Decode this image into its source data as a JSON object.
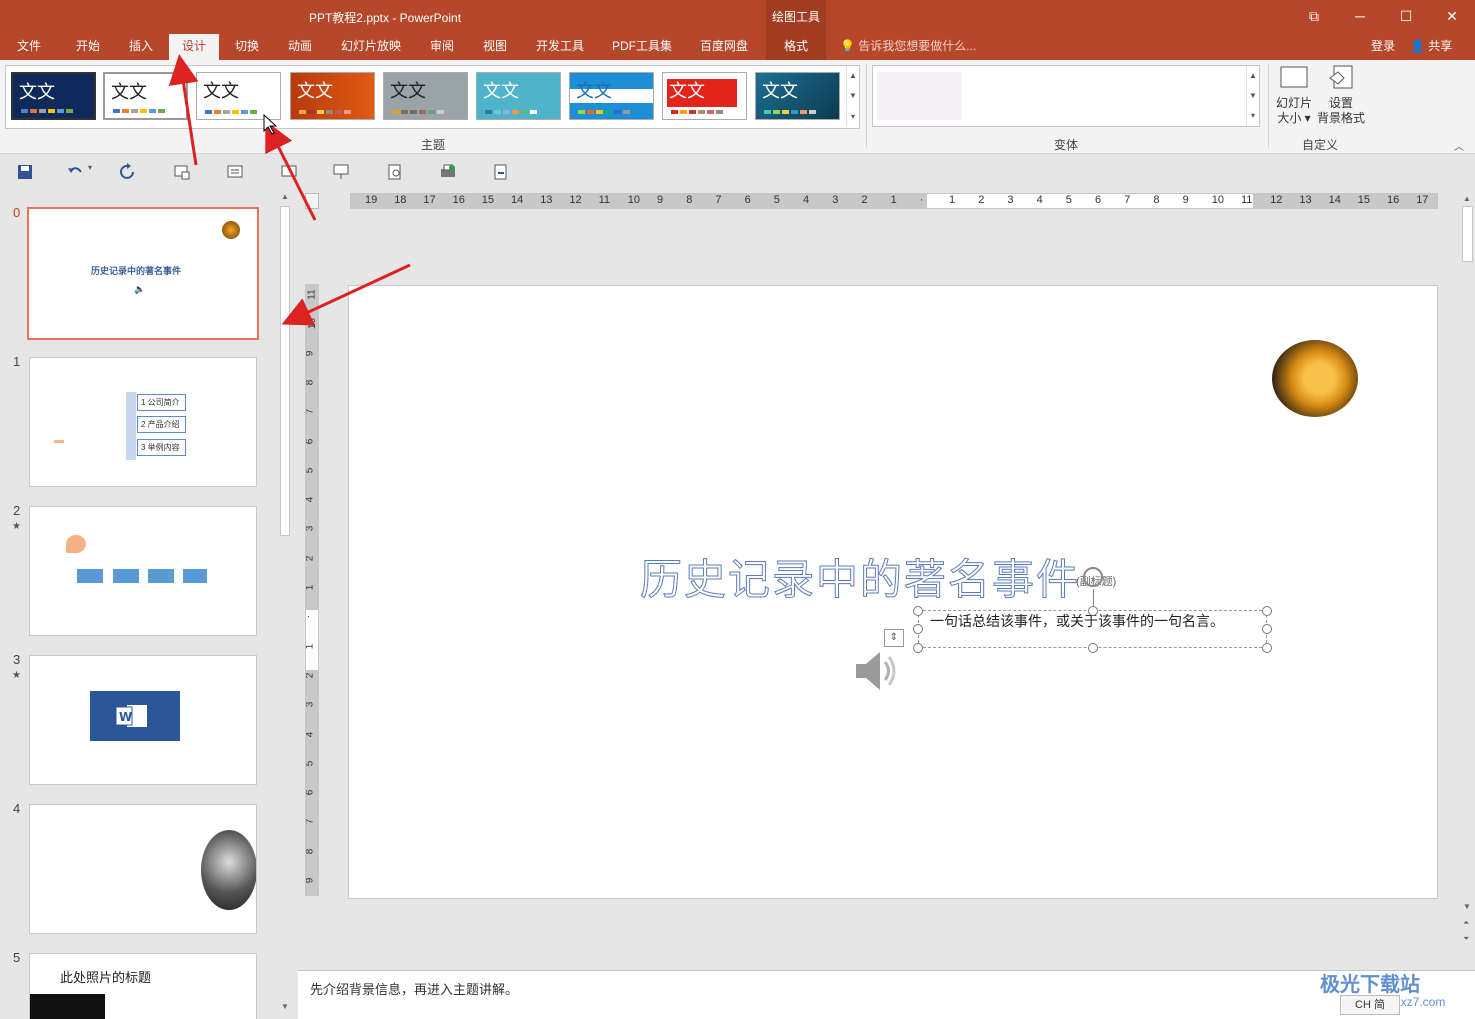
{
  "window": {
    "title": "PPT教程2.pptx - PowerPoint",
    "context_tool": "绘图工具",
    "restore_glyph": "⧉",
    "minimize_glyph": "─",
    "maximize_glyph": "☐",
    "close_glyph": "✕"
  },
  "tabs": [
    {
      "label": "文件"
    },
    {
      "label": "开始"
    },
    {
      "label": "插入"
    },
    {
      "label": "设计"
    },
    {
      "label": "切换"
    },
    {
      "label": "动画"
    },
    {
      "label": "幻灯片放映"
    },
    {
      "label": "审阅"
    },
    {
      "label": "视图"
    },
    {
      "label": "开发工具"
    },
    {
      "label": "PDF工具集"
    },
    {
      "label": "百度网盘"
    },
    {
      "label": "格式"
    }
  ],
  "active_tab": "设计",
  "tellme": "告诉我您想要做什么...",
  "account": {
    "login": "登录",
    "share": "共享"
  },
  "ribbon": {
    "themes_group_label": "主题",
    "variants_group_label": "变体",
    "customize_group_label": "自定义",
    "theme_sample_text": "文文",
    "slide_size_label": "幻灯片\n大小",
    "slide_size_line1": "幻灯片",
    "slide_size_line2": "大小 ▾",
    "bg_format_line1": "设置",
    "bg_format_line2": "背景格式"
  },
  "slides": [
    {
      "number": "0",
      "title": "历史记录中的著名事件",
      "has_star": false
    },
    {
      "number": "1",
      "items": [
        "1 公司简介",
        "2 产品介绍",
        "3 举例内容"
      ],
      "has_star": false
    },
    {
      "number": "2",
      "has_star": true
    },
    {
      "number": "3",
      "has_star": true
    },
    {
      "number": "4",
      "has_star": false
    },
    {
      "number": "5",
      "title": "此处照片的标题",
      "has_star": false
    }
  ],
  "main_slide": {
    "title": "历史记录中的著名事件",
    "subtitle_tag": "(副标题)",
    "subtitle": "一句话总结该事件，或关于该事件的一句名言。"
  },
  "notes": "先介绍背景信息，再进入主题讲解。",
  "ruler": {
    "h_labels": [
      "19",
      "18",
      "17",
      "16",
      "15",
      "14",
      "13",
      "12",
      "11",
      "10",
      "9",
      "8",
      "7",
      "6",
      "5",
      "4",
      "3",
      "2",
      "1",
      "·",
      "1",
      "2",
      "3",
      "4",
      "5",
      "6",
      "7",
      "8",
      "9",
      "10",
      "11",
      "12",
      "13",
      "14",
      "15",
      "16",
      "17"
    ],
    "v_labels": [
      "11",
      "10",
      "9",
      "8",
      "7",
      "6",
      "5",
      "4",
      "3",
      "2",
      "1",
      "·",
      "1",
      "2",
      "3",
      "4",
      "5",
      "6",
      "7",
      "8",
      "9"
    ]
  },
  "watermark": {
    "line1": "极光下载站",
    "line2": "www.xz7.com",
    "ime": "CH 简"
  },
  "colors": {
    "accent": "#b7472a",
    "title_stroke": "#5b7cba",
    "selection": "#e8755a"
  }
}
